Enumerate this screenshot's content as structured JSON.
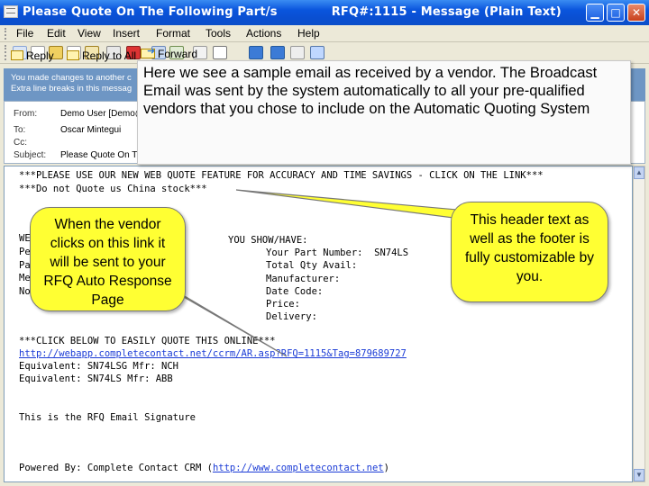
{
  "window": {
    "title": "Please Quote On The Following Part/s",
    "title_rfq": "RFQ#:1115 - Message (Plain Text)",
    "minimize_glyph": "▁",
    "maximize_glyph": "□",
    "close_glyph": "✕"
  },
  "menu": {
    "items": [
      "File",
      "Edit",
      "View",
      "Insert",
      "Format",
      "Tools",
      "Actions",
      "Help"
    ]
  },
  "toolbar": {
    "reply": "Reply",
    "reply_to_all": "Reply to All",
    "forward": "Forward"
  },
  "infobar": {
    "line1": "You made changes to another c",
    "line2": "Extra line breaks in this messag"
  },
  "header": {
    "from_label": "From:",
    "from_value": "Demo User [Demo@",
    "to_label": "To:",
    "to_value": "Oscar Mintegui",
    "cc_label": "Cc:",
    "cc_value": "",
    "subject_label": "Subject:",
    "subject_value": "Please Quote On The"
  },
  "body": {
    "line1": "***PLEASE USE OUR NEW WEB QUOTE FEATURE FOR ACCURACY AND TIME SAVINGS - CLICK ON THE LINK***",
    "line2": "***Do not Quote us China stock***",
    "left_partial": [
      "WE",
      "Pe",
      "Pa",
      "Me",
      "No"
    ],
    "you_show": "YOU SHOW/HAVE:",
    "part_number_label": "Your Part Number:",
    "part_number_value": "SN74LS",
    "total_qty": "Total Qty Avail:",
    "manufacturer": "Manufacturer:",
    "date_code": "Date Code:",
    "price": "Price:",
    "delivery": "Delivery:",
    "click_below": "***CLICK BELOW TO EASILY QUOTE THIS ONLINE***",
    "link": "http://webapp.completecontact.net/ccrm/AR.asp?RFQ=1115&Tag=879689727",
    "equivalent1": "Equivalent: SN74LSG Mfr: NCH",
    "equivalent2": "Equivalent: SN74LS Mfr: ABB",
    "signature": "This is the RFQ Email Signature",
    "powered_by": "Powered By: Complete Contact CRM (",
    "powered_link": "http://www.completecontact.net",
    "powered_end": ")"
  },
  "callouts": {
    "main": "Here we see a sample email as received by a vendor. The Broadcast Email was sent by the system automatically to all your pre-qualified vendors that you chose to include on the Automatic Quoting System",
    "left": "When the vendor clicks on this link it will be sent to your RFQ Auto Response Page",
    "right": "This header text as well as the footer is fully customizable by you."
  },
  "colors": {
    "titlebar": "#0a55dd",
    "callout_yellow": "#ffff33",
    "link": "#1a3bd6"
  }
}
